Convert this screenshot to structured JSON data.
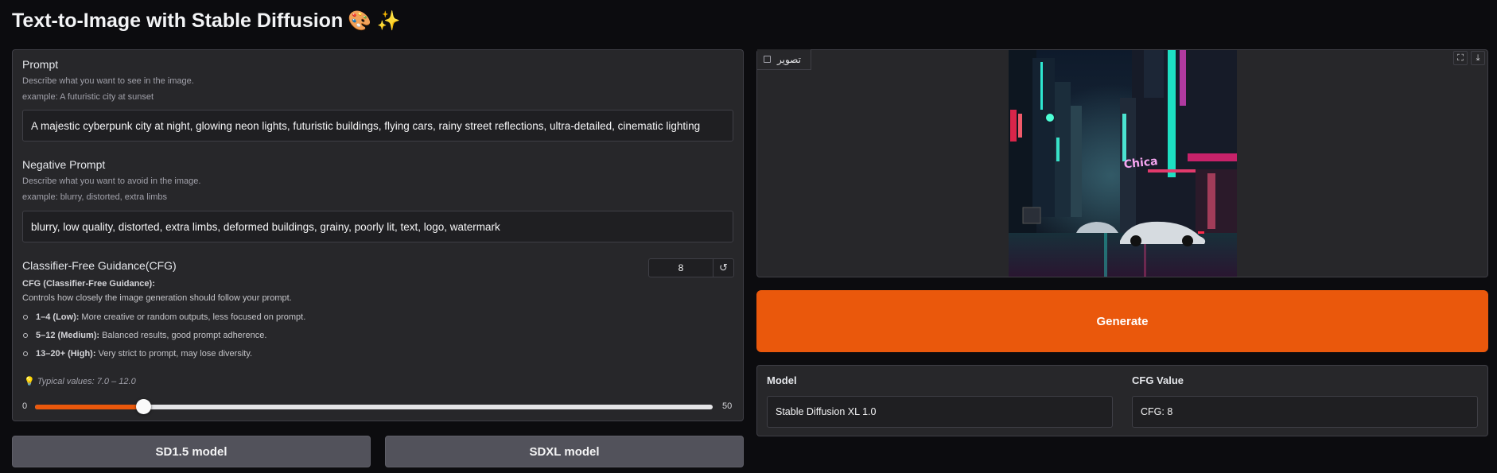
{
  "page": {
    "title": "Text-to-Image with Stable Diffusion",
    "title_emoji": "🎨 ✨"
  },
  "prompt": {
    "label": "Prompt",
    "hint_line1": "Describe what you want to see in the image.",
    "hint_line2": "example: A futuristic city at sunset",
    "value": "A majestic cyberpunk city at night, glowing neon lights, futuristic buildings, flying cars, rainy street reflections, ultra-detailed, cinematic lighting"
  },
  "negative_prompt": {
    "label": "Negative Prompt",
    "hint_line1": "Describe what you want to avoid in the image.",
    "hint_line2": "example: blurry, distorted, extra limbs",
    "value": "blurry, low quality, distorted, extra limbs, deformed buildings, grainy, poorly lit, text, logo, watermark"
  },
  "cfg": {
    "label": "Classifier-Free Guidance(CFG)",
    "value": "8",
    "reset_icon": "↺",
    "heading": "CFG (Classifier-Free Guidance):",
    "description": "Controls how closely the image generation should follow your prompt.",
    "bullets": [
      {
        "term": "1–4 (Low):",
        "text": "More creative or random outputs, less focused on prompt."
      },
      {
        "term": "5–12 (Medium):",
        "text": "Balanced results, good prompt adherence."
      },
      {
        "term": "13–20+ (High):",
        "text": "Very strict to prompt, may lose diversity."
      }
    ],
    "tip_icon": "💡",
    "tip": "Typical values: 7.0 – 12.0",
    "slider": {
      "min": "0",
      "max": "50",
      "min_value": 0,
      "max_value": 50,
      "current": 8
    }
  },
  "buttons": {
    "sd15": "SD1.5 model",
    "sdxl": "SDXL model",
    "generate": "Generate"
  },
  "output": {
    "image_label": "تصوير",
    "image_icon": "image-icon",
    "fullscreen_icon": "⛶",
    "download_icon": "⤓",
    "accent": "#ea580c"
  },
  "info": {
    "model_label": "Model",
    "model_value": "Stable Diffusion XL 1.0",
    "cfg_label": "CFG Value",
    "cfg_value": "CFG: 8"
  }
}
